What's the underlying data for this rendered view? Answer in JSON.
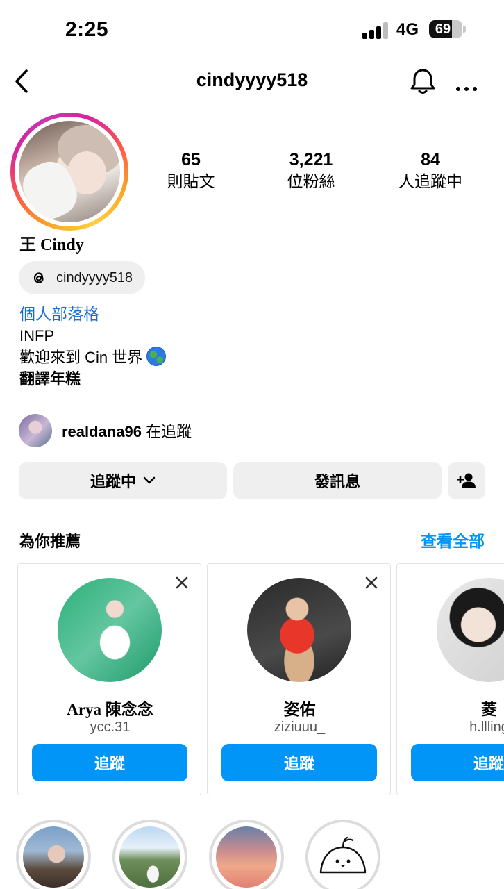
{
  "status_bar": {
    "time": "2:25",
    "network": "4G",
    "battery": "69",
    "battery_level": 0.69
  },
  "header": {
    "username": "cindyyyy518"
  },
  "profile": {
    "stats": [
      {
        "value": "65",
        "label": "則貼文"
      },
      {
        "value": "3,221",
        "label": "位粉絲"
      },
      {
        "value": "84",
        "label": "人追蹤中"
      }
    ],
    "display_name": "王 Cindy",
    "threads_handle": "cindyyyy518",
    "bio": {
      "link": "個人部落格",
      "line1": "INFP",
      "line2": "歡迎來到 Cin 世界",
      "line3": "翻譯年糕"
    },
    "mutual": {
      "user": "realdana96",
      "suffix": " 在追蹤"
    }
  },
  "actions": {
    "following": "追蹤中",
    "message": "發訊息"
  },
  "suggestions": {
    "title": "為你推薦",
    "see_all": "查看全部",
    "cards": [
      {
        "name": "Arya 陳念念",
        "handle": "ycc.31",
        "follow": "追蹤"
      },
      {
        "name": "姿佑",
        "handle": "ziziuuu_",
        "follow": "追蹤"
      },
      {
        "name": "菱",
        "handle": "h.llling",
        "follow": "追蹤"
      }
    ]
  },
  "colors": {
    "accent": "#0095f6",
    "link": "#1a6fd1",
    "button_bg": "#efefef"
  }
}
